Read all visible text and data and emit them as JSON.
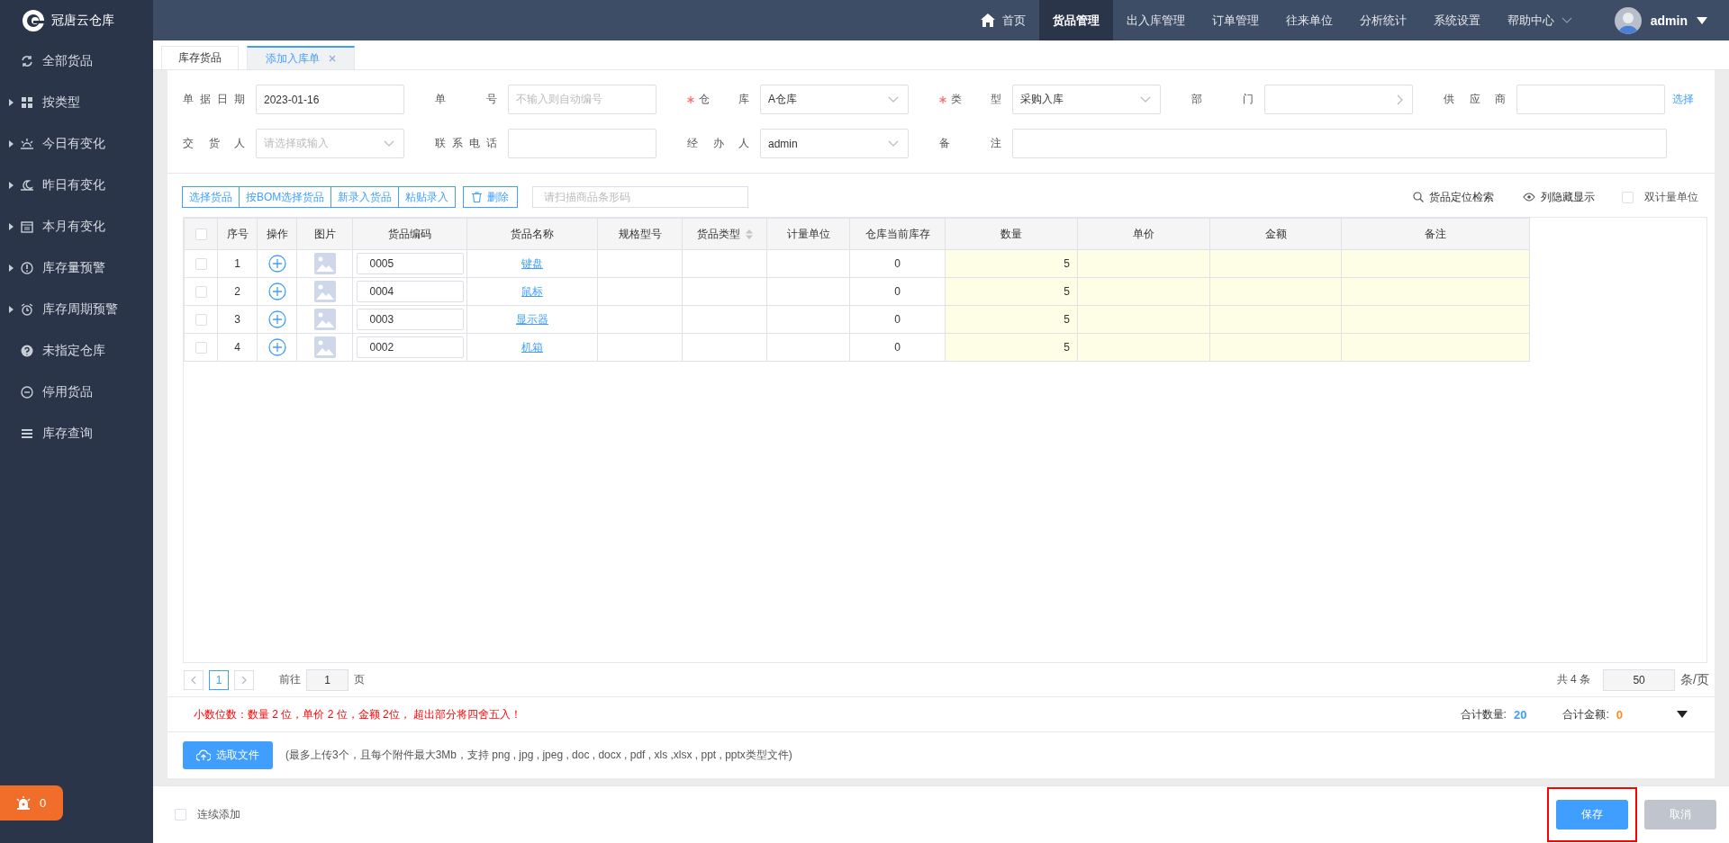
{
  "app": {
    "name": "冠唐云仓库"
  },
  "nav": [
    {
      "label": "首页",
      "selected": false,
      "dropdown": false
    },
    {
      "label": "货品管理",
      "selected": true,
      "dropdown": false
    },
    {
      "label": "出入库管理",
      "selected": false,
      "dropdown": false
    },
    {
      "label": "订单管理",
      "selected": false,
      "dropdown": false
    },
    {
      "label": "往来单位",
      "selected": false,
      "dropdown": false
    },
    {
      "label": "分析统计",
      "selected": false,
      "dropdown": false
    },
    {
      "label": "系统设置",
      "selected": false,
      "dropdown": false
    },
    {
      "label": "帮助中心",
      "selected": false,
      "dropdown": true
    }
  ],
  "user": {
    "name": "admin"
  },
  "sidebar": {
    "items": [
      {
        "label": "全部货品",
        "has_children": false
      },
      {
        "label": "按类型",
        "has_children": true
      },
      {
        "label": "今日有变化",
        "has_children": true
      },
      {
        "label": "昨日有变化",
        "has_children": true
      },
      {
        "label": "本月有变化",
        "has_children": true
      },
      {
        "label": "库存量预警",
        "has_children": true
      },
      {
        "label": "库存周期预警",
        "has_children": true
      },
      {
        "label": "未指定仓库",
        "has_children": false
      },
      {
        "label": "停用货品",
        "has_children": false
      },
      {
        "label": "库存查询",
        "has_children": false
      }
    ],
    "alert_badge": {
      "count": "0"
    }
  },
  "tabs": [
    {
      "label": "库存货品",
      "selected": false,
      "closable": false
    },
    {
      "label": "添加入库单",
      "selected": true,
      "closable": true
    }
  ],
  "form": {
    "fields": [
      {
        "label": "单据日期",
        "kind": "text",
        "required": false,
        "value": "2023-01-16"
      },
      {
        "label": "单号",
        "kind": "text",
        "required": false,
        "placeholder": "不输入则自动编号"
      },
      {
        "label": "仓库",
        "kind": "select",
        "required": true,
        "value": "A仓库"
      },
      {
        "label": "类型",
        "kind": "select",
        "required": true,
        "value": "采购入库"
      },
      {
        "label": "部门",
        "kind": "picker",
        "required": false
      },
      {
        "label": "供应商",
        "kind": "text",
        "required": false,
        "link": "选择"
      },
      {
        "label": "交货人",
        "kind": "select",
        "required": false,
        "placeholder": "请选择或输入"
      },
      {
        "label": "联系电话",
        "kind": "text",
        "required": false
      },
      {
        "label": "经办人",
        "kind": "select",
        "required": false,
        "value": "admin"
      },
      {
        "label": "备注",
        "kind": "wide",
        "required": false
      }
    ]
  },
  "toolbar": {
    "group_buttons": [
      "选择货品",
      "按BOM选择货品",
      "新录入货品",
      "粘贴录入"
    ],
    "delete_button": "删除",
    "scan_placeholder": "请扫描商品条形码",
    "locate_link": "货品定位检索",
    "columns_link": "列隐藏显示",
    "dual_unit": {
      "label": "双计量单位",
      "checked": false
    }
  },
  "table": {
    "columns": [
      {
        "label": "序号",
        "sortable": false,
        "editable": false
      },
      {
        "label": "操作",
        "sortable": false,
        "editable": false
      },
      {
        "label": "图片",
        "sortable": false,
        "editable": false
      },
      {
        "label": "货品编码",
        "sortable": false,
        "editable": false
      },
      {
        "label": "货品名称",
        "sortable": false,
        "editable": false
      },
      {
        "label": "规格型号",
        "sortable": false,
        "editable": false
      },
      {
        "label": "货品类型",
        "sortable": true,
        "editable": false
      },
      {
        "label": "计量单位",
        "sortable": false,
        "editable": false
      },
      {
        "label": "仓库当前库存",
        "sortable": false,
        "editable": false
      },
      {
        "label": "数量",
        "sortable": false,
        "editable": true
      },
      {
        "label": "单价",
        "sortable": false,
        "editable": true
      },
      {
        "label": "金额",
        "sortable": false,
        "editable": true
      },
      {
        "label": "备注",
        "sortable": false,
        "editable": true
      }
    ],
    "rows": [
      {
        "checked": false,
        "index": "1",
        "code": "0005",
        "name": "键盘",
        "stock": "0",
        "quantity": "5"
      },
      {
        "checked": false,
        "index": "2",
        "code": "0004",
        "name": "鼠标",
        "stock": "0",
        "quantity": "5"
      },
      {
        "checked": false,
        "index": "3",
        "code": "0003",
        "name": "显示器",
        "stock": "0",
        "quantity": "5"
      },
      {
        "checked": false,
        "index": "4",
        "code": "0002",
        "name": "机箱",
        "stock": "0",
        "quantity": "5"
      }
    ]
  },
  "pagination": {
    "pages": [
      {
        "label": "1",
        "selected": true
      }
    ],
    "goto_label": "前往",
    "goto_value": "1",
    "page_unit": "页",
    "total": "共 4 条",
    "page_size": "50",
    "size_unit": "条/页"
  },
  "notice": "小数位数：数量 2 位，单价 2 位，金额 2位， 超出部分将四舍五入！",
  "totals": [
    {
      "label": "合计数量:",
      "value": "20",
      "color": "#409eff"
    },
    {
      "label": "合计金额:",
      "value": "0",
      "color": "#ff8c1a"
    }
  ],
  "upload": {
    "button": "选取文件",
    "hint": "(最多上传3个，且每个附件最大3Mb，支持 png , jpg , jpeg , doc , docx , pdf , xls ,xlsx , ppt , pptx类型文件)"
  },
  "footer": {
    "continue_add": {
      "label": "连续添加",
      "checked": false
    },
    "buttons": [
      {
        "label": "保存",
        "kind": "primary",
        "disabled": false,
        "highlighted": true
      },
      {
        "label": "取消",
        "kind": "secondary",
        "disabled": true,
        "highlighted": false
      }
    ]
  }
}
